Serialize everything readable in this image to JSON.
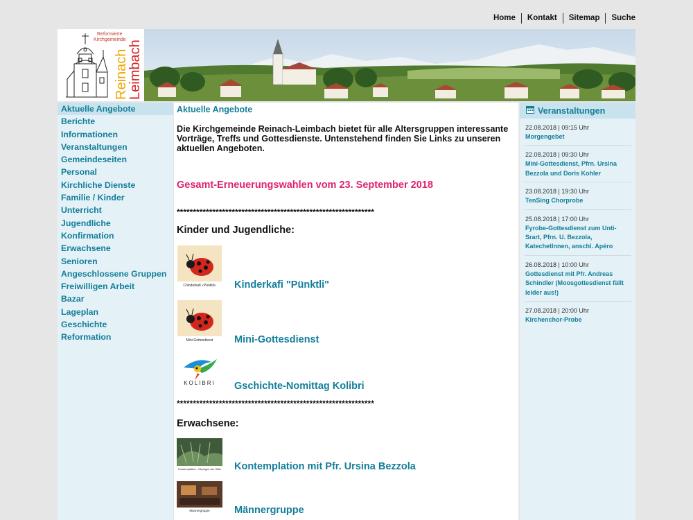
{
  "topnav": [
    "Home",
    "Kontakt",
    "Sitemap",
    "Suche"
  ],
  "logo": {
    "line1": "Reformierte",
    "line2": "Kirchgemeinde",
    "word1": "Reinach",
    "word2": "Leimbach"
  },
  "sidebar": {
    "items": [
      "Aktuelle Angebote",
      "Berichte",
      "Informationen",
      "Veranstaltungen",
      "Gemeindeseiten",
      "Personal",
      "Kirchliche Dienste",
      "Familie / Kinder",
      "Unterricht",
      "Jugendliche",
      "Konfirmation",
      "Erwachsene",
      "Senioren",
      "Angeschlossene Gruppen",
      "Freiwilligen Arbeit",
      "Bazar",
      "Lageplan",
      "Geschichte",
      "Reformation"
    ]
  },
  "main": {
    "title": "Aktuelle Angebote",
    "intro": "Die Kirchgemeinde Reinach-Leimbach bietet für alle Altersgruppen interessante Vorträge, Treffs und Gottesdienste. Untenstehend finden Sie Links zu unseren aktuellen Angeboten.",
    "highlight": "Gesamt-Erneuerungswahlen vom 23. September 2018",
    "stars": "*************************************************************",
    "kids_heading": "Kinder und Jugendliche:",
    "adults_heading": "Erwachsene:",
    "offers": [
      {
        "label": "Kinderkafi \"Pünktli\"",
        "caption": "Chinderkafi «Pünktli»"
      },
      {
        "label": "Mini-Gottesdienst",
        "caption": "Mini-Gottesdienst"
      },
      {
        "label": "Gschichte-Nomittag Kolibri",
        "caption": "KOLIBRI"
      },
      {
        "label": "Kontemplation mit Pfr. Ursina Bezzola",
        "caption": "Kontemplation - Übungen der Stille"
      },
      {
        "label": "Männergruppe",
        "caption": "Männergruppe"
      }
    ]
  },
  "events": {
    "title": "Veranstaltungen",
    "items": [
      {
        "date": "22.08.2018 | 09:15 Uhr",
        "title": "Morgengebet"
      },
      {
        "date": "22.08.2018 | 09:30 Uhr",
        "title": "Mini-Gottesdienst, Pfrn. Ursina Bezzola und Doris Kohler"
      },
      {
        "date": "23.08.2018 | 19:30 Uhr",
        "title": "TenSing Chorprobe"
      },
      {
        "date": "25.08.2018 | 17:00 Uhr",
        "title": "Fyrobe-Gottesdienst zum Unti-Srart, Pfrn. U. Bezzola, KatechetInnen, anschl. Apéro"
      },
      {
        "date": "26.08.2018 | 10:00 Uhr",
        "title": "Gottesdienst mit Pfr. Andreas Schindler (Moosgottesdienst fällt leider aus!)"
      },
      {
        "date": "27.08.2018 | 20:00 Uhr",
        "title": "Kirchenchor-Probe"
      }
    ]
  }
}
